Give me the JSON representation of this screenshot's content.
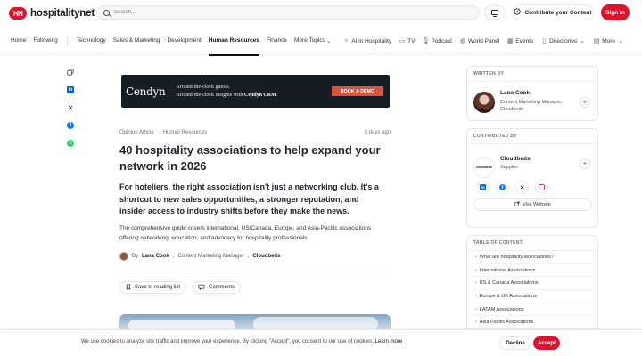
{
  "header": {
    "logo_mark": "HN",
    "logo_text": "hospitalitynet",
    "search_placeholder": "Search...",
    "contribute_label": "Contribute your Content",
    "signin_label": "Sign In"
  },
  "nav": {
    "primary": [
      "Home",
      "Following"
    ],
    "topics": [
      "Technology",
      "Sales & Marketing",
      "Development",
      "Human Resources",
      "Finance",
      "More Topics"
    ],
    "active_topic": "Human Resources",
    "right": [
      "AI in Hospitality",
      "TV",
      "Podcast",
      "World Panel",
      "Events",
      "Directories",
      "More"
    ]
  },
  "banner": {
    "logo": "Cendyn",
    "line1": "Around-the-clock guests.",
    "line2_prefix": "Around-the-clock insights with ",
    "line2_bold": "Cendyn CRM",
    "line2_suffix": ".",
    "cta": "BOOK A DEMO"
  },
  "article": {
    "type": "Opinion Article",
    "category": "Human Resources",
    "age": "3 days ago",
    "title": "40 hospitality associations to help expand your network in 2026",
    "lead": "For hoteliers, the right association isn't just a networking club. It's a shortcut to new sales opportunities, a stronger reputation, and insider access to industry shifts before they make the news.",
    "description": "The comprehensive guide covers international, US/Canada, Europe, and Asia-Pacific associations offering networking, education, and advocacy for hospitality professionals.",
    "byline_prefix": "By",
    "author": "Lana Cook",
    "author_role": "Content Marketing Manager",
    "company": "Cloudbeds",
    "save_label": "Save to reading list",
    "comments_label": "Comments"
  },
  "sidebar": {
    "written_by": {
      "heading": "WRITTEN BY",
      "name": "Lana Cook",
      "role": "Content Marketing Manager, Cloudbeds"
    },
    "contributed_by": {
      "heading": "CONTRIBUTED BY",
      "logo_text": "cloudbeds",
      "name": "Cloudbeds",
      "type": "Supplier",
      "visit_label": "Visit Website"
    },
    "toc": {
      "heading": "TABLE OF CONTENT",
      "items": [
        "What are hospitality associations?",
        "International Associations",
        "US & Canada Associations",
        "Europe & UK Associations",
        "LATAM Associations",
        "Asia Pacific Associations"
      ]
    }
  },
  "cookie": {
    "text": "We use cookies to analyze site traffic and improve your experience. By clicking \"Accept\", you consent to our use of cookies.",
    "link": "Learn more",
    "decline": "Decline",
    "accept": "Accept"
  },
  "colors": {
    "brand_red": "#e0132f",
    "banner_bg": "#161d24",
    "banner_cta": "#d8553a",
    "linkedin": "#0a66c2",
    "facebook": "#1877f2",
    "whatsapp": "#25d366",
    "instagram": "#e1306c"
  }
}
